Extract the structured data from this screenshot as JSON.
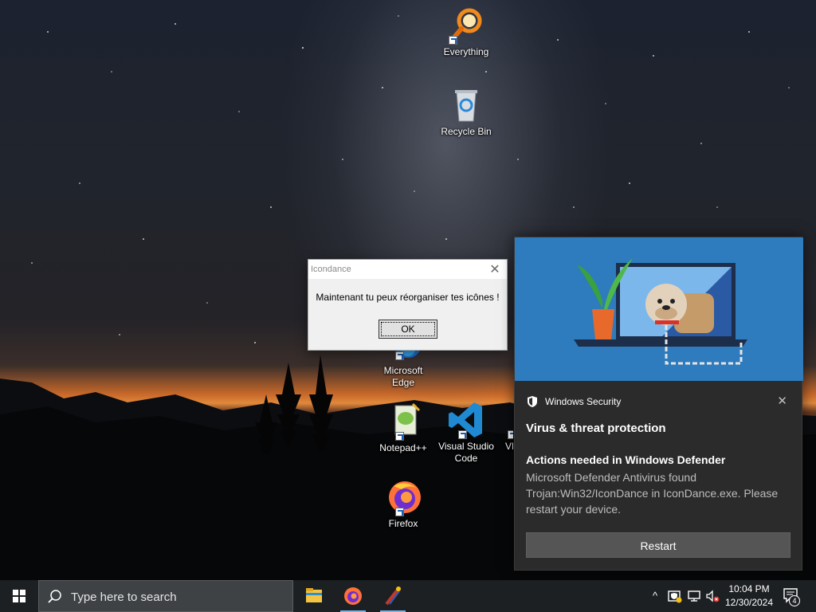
{
  "desktop": {
    "icons": [
      {
        "label": "Everything"
      },
      {
        "label": "Recycle Bin"
      },
      {
        "label": "Microsoft Edge"
      },
      {
        "label": "Notepad++"
      },
      {
        "label": "Visual Studio Code"
      },
      {
        "label": "VL"
      },
      {
        "label": "Firefox"
      }
    ]
  },
  "dialog": {
    "title": "Icondance",
    "close_glyph": "✕",
    "message": "Maintenant tu peux réorganiser tes icônes !",
    "ok_label": "OK"
  },
  "toast": {
    "app_name": "Windows Security",
    "close_glyph": "✕",
    "section": "Virus & threat protection",
    "headline": "Actions needed in Windows Defender",
    "body": "Microsoft Defender Antivirus found Trojan:Win32/IconDance in IconDance.exe. Please restart your device.",
    "restart_label": "Restart",
    "hero_color": "#2e7bbd"
  },
  "taskbar": {
    "search_placeholder": "Type here to search",
    "apps": [
      "file-explorer-icon",
      "firefox-icon",
      "icondance-icon"
    ],
    "tray": {
      "chevron": "^",
      "time": "10:04 PM",
      "date": "12/30/2024",
      "notification_count": "4"
    }
  },
  "colors": {
    "taskbar_bg": "#1d2023",
    "search_bg": "#3f4245",
    "toast_bg": "#2b2b2b",
    "accent_underline": "#7ab3e6"
  }
}
